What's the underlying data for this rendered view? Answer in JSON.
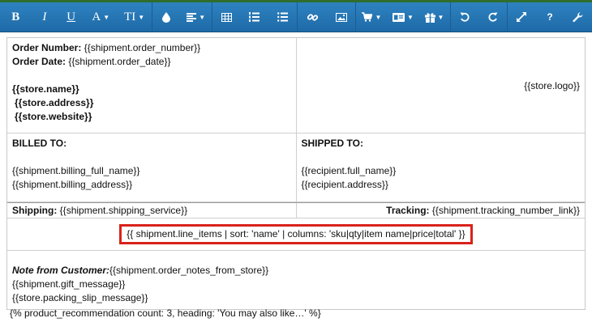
{
  "toolbar": {
    "bold_label": "B",
    "italic_label": "I",
    "underline_label": "U",
    "font_color_label": "A",
    "font_size_label": "TI",
    "icons": [
      "bold-icon",
      "italic-icon",
      "underline-icon",
      "font-color-icon",
      "font-size-icon",
      "color-drop-icon",
      "align-icon",
      "table-icon",
      "ordered-list-icon",
      "bullet-list-icon",
      "link-icon",
      "image-icon",
      "cart-icon",
      "address-card-icon",
      "gift-icon",
      "undo-icon",
      "redo-icon",
      "fullscreen-icon",
      "help-icon",
      "wrench-icon"
    ],
    "help_label": "?"
  },
  "doc": {
    "order_number_label": "Order Number:",
    "order_number_value": "{{shipment.order_number}}",
    "order_date_label": "Order Date:",
    "order_date_value": "{{shipment.order_date}}",
    "store_name": "{{store.name}}",
    "store_address": "{{store.address}}",
    "store_website": "{{store.website}}",
    "store_logo": "{{store.logo}}",
    "billed_to_label": "BILLED TO:",
    "billing_full_name": "{{shipment.billing_full_name}}",
    "billing_address": "{{shipment.billing_address}}",
    "shipped_to_label": "SHIPPED TO:",
    "recipient_full_name": "{{recipient.full_name}}",
    "recipient_address": "{{recipient.address}}",
    "shipping_label": "Shipping:",
    "shipping_value": "{{shipment.shipping_service}}",
    "tracking_label": "Tracking:",
    "tracking_value": "{{shipment.tracking_number_link}}",
    "line_items": "{{ shipment.line_items | sort: 'name' | columns: 'sku|qty|item name|price|total' }}",
    "note_label": "Note from Customer:",
    "note_value": "{{shipment.order_notes_from_store}}",
    "gift_message": "{{shipment.gift_message}}",
    "packing_slip_message": "{{store.packing_slip_message}}",
    "product_recommendation": "{% product_recommendation count: 3, heading: 'You may also like…' %}"
  },
  "colors": {
    "toolbar": "#2378b8",
    "highlight_border": "#d9221a"
  }
}
